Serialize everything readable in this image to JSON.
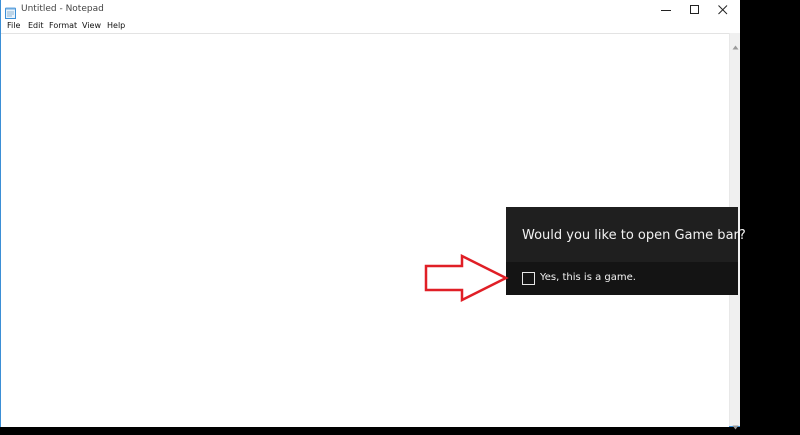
{
  "window": {
    "title": "Untitled - Notepad",
    "app_icon": "notepad-icon",
    "controls": [
      "minimize-icon",
      "maximize-icon",
      "close-icon"
    ]
  },
  "menubar": {
    "items": [
      "File",
      "Edit",
      "Format",
      "View",
      "Help"
    ]
  },
  "editor": {
    "content": ""
  },
  "gamebar_prompt": {
    "question": "Would you like to open Game bar?",
    "checkbox_label": "Yes, this is a game.",
    "checkbox_checked": false
  },
  "annotation": {
    "arrow_color": "#e01f26"
  },
  "colors": {
    "prompt_background": "#1f1f1f",
    "prompt_option_background": "#141414",
    "window_border": "#3b8fd6"
  }
}
